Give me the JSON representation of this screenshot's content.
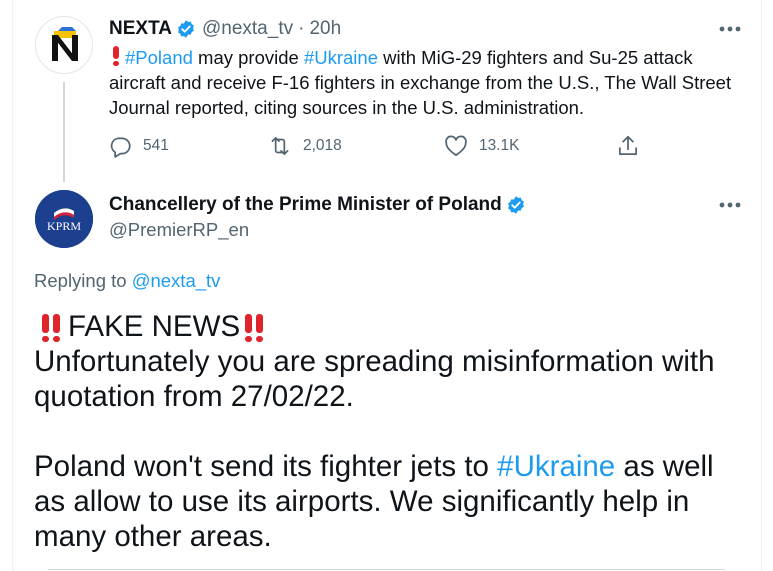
{
  "tweet1": {
    "author_name": "NEXTA",
    "handle": "@nexta_tv",
    "separator": "·",
    "time": "20h",
    "text_segments": [
      {
        "text": "#Poland",
        "style": "hashtag"
      },
      {
        "text": " may provide ",
        "style": "plain"
      },
      {
        "text": "#Ukraine",
        "style": "hashtag"
      },
      {
        "text": " with MiG-29 fighters and Su-25 attack aircraft and receive F-16 fighters in exchange from the U.S., The Wall Street Journal reported, citing sources in the U.S. administration.",
        "style": "plain"
      }
    ],
    "replies": "541",
    "retweets": "2,018",
    "likes": "13.1K"
  },
  "tweet2": {
    "author_name": "Chancellery of the Prime Minister of Poland",
    "handle": "@PremierRP_en",
    "avatar_text": "KPRM",
    "replying_prefix": "Replying to ",
    "replying_to": "@nexta_tv",
    "fake_news": "FAKE NEWS",
    "line1": "Unfortunately you are spreading misinformation with quotation from 27/02/22.",
    "line2_before": "Poland won't send its fighter jets to ",
    "line2_hashtag": "#Ukraine",
    "line2_after": " as well as allow to use its airports. We significantly help in many other areas."
  },
  "colors": {
    "accent": "#1d9bf0",
    "secondary_text": "#536471",
    "alert_red": "#e0242c",
    "kprm_blue": "#1c3f8f"
  },
  "icons": [
    "verified-badge-icon",
    "more-icon",
    "reply-icon",
    "retweet-icon",
    "like-icon",
    "share-icon",
    "exclamation-icon",
    "double-exclamation-icon"
  ]
}
